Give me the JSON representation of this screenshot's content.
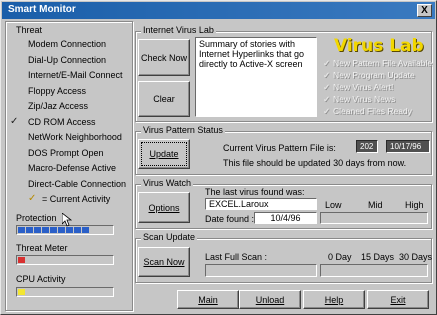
{
  "window": {
    "title": "Smart Monitor",
    "close_label": "X"
  },
  "sidebar": {
    "threat_title": "Threat",
    "items": [
      {
        "label": "Modem Connection",
        "checked": false
      },
      {
        "label": "Dial-Up Connection",
        "checked": false
      },
      {
        "label": "Internet/E-Mail Connect",
        "checked": false
      },
      {
        "label": "Floppy Access",
        "checked": false
      },
      {
        "label": "Zip/Jaz Access",
        "checked": false
      },
      {
        "label": "CD ROM Access",
        "checked": true
      },
      {
        "label": "NetWork Neighborhood",
        "checked": false
      },
      {
        "label": "DOS Prompt Open",
        "checked": false
      },
      {
        "label": "Macro-Defense Active",
        "checked": false
      },
      {
        "label": "Direct-Cable Connection",
        "checked": false
      }
    ],
    "legend_label": "= Current Activity",
    "protection_label": "Protection",
    "protection_segments": 9,
    "threat_meter_label": "Threat Meter",
    "threat_level": 0.1,
    "cpu_label": "CPU Activity",
    "cpu_level": 0.08,
    "colors": {
      "protection": "#2a5fc8",
      "threat": "#d83030",
      "cpu": "#f2e632"
    }
  },
  "internet_lab": {
    "title": "Internet Virus Lab",
    "check_button": "Check Now",
    "clear_button": "Clear",
    "summary_text": "Summary of stories with Internet Hyperlinks that go directly to Active-X screen",
    "logo_text": "Virus Lab",
    "options": [
      "New Pattern File Available",
      "New Program Update",
      "New Virus Alert!",
      "New Virus News",
      "Cleaned Files Ready"
    ]
  },
  "pattern": {
    "title": "Virus Pattern Status",
    "update_button": "Update",
    "current_label": "Current Virus Pattern File is:",
    "file_number": "202",
    "file_date": "10/17/96",
    "note": "This file should be updated 30 days from  now."
  },
  "watch": {
    "title": "Virus Watch",
    "options_button": "Options",
    "last_found_label": "The last virus found was:",
    "last_found_value": "EXCEL.Laroux",
    "date_label": "Date found :",
    "date_value": "10/4/96",
    "levels": [
      "Low",
      "Mid",
      "High"
    ]
  },
  "scan": {
    "title": "Scan Update",
    "scan_button": "Scan Now",
    "last_scan_label": "Last Full Scan :",
    "day_labels": [
      "0 Day",
      "15 Days",
      "30 Days"
    ]
  },
  "footer": {
    "main_button": "Main",
    "unload_button": "Unload",
    "help_button": "Help",
    "exit_button": "Exit"
  }
}
